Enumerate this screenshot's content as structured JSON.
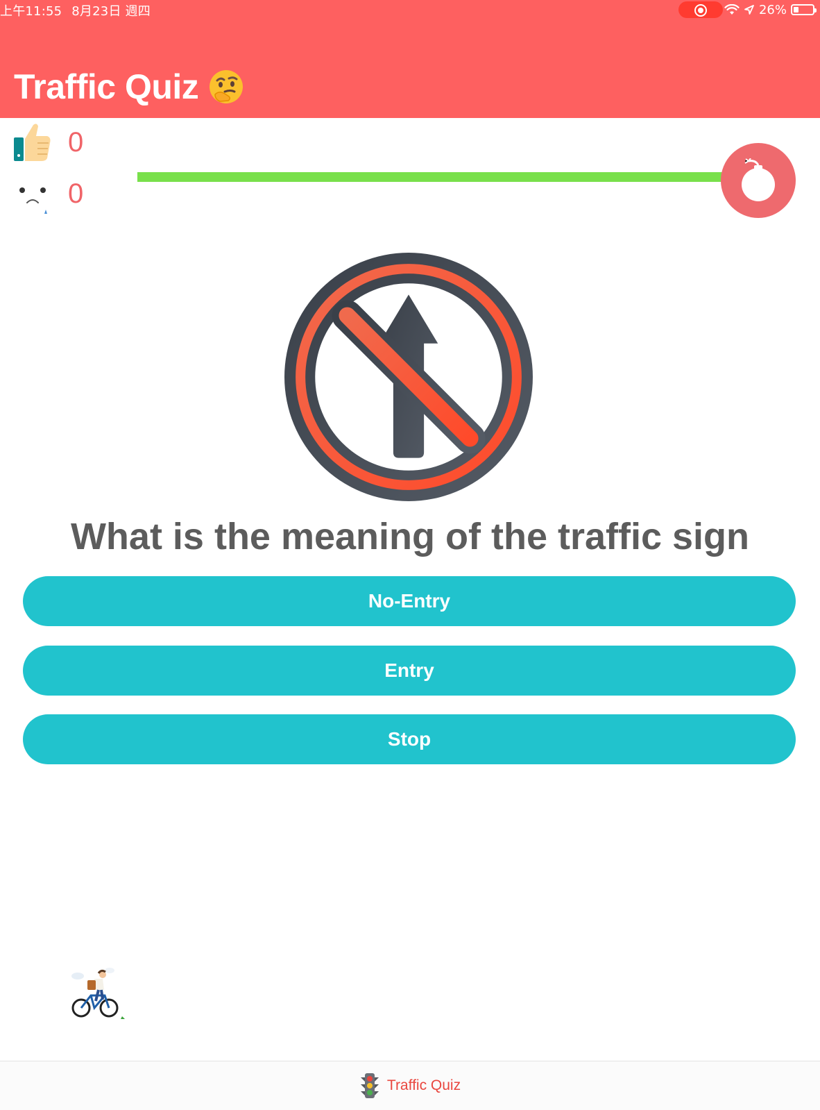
{
  "status_bar": {
    "time": "上午11:55",
    "date": "8月23日 週四",
    "battery": "26%",
    "battery_level": 0.26
  },
  "header": {
    "title": "Traffic Quiz"
  },
  "score": {
    "correct": "0",
    "wrong": "0"
  },
  "timer": {
    "progress": 1.0
  },
  "question": {
    "text": "What is the meaning of the traffic sign"
  },
  "answers": [
    {
      "label": "No-Entry"
    },
    {
      "label": "Entry"
    },
    {
      "label": "Stop"
    }
  ],
  "tab_bar": {
    "items": [
      {
        "label": "Traffic Quiz",
        "icon": "traffic-light-icon"
      }
    ]
  },
  "colors": {
    "header": "#fe6060",
    "accent": "#21c3cd",
    "progress": "#79e04b",
    "score": "#f06468",
    "bomb": "#ee6a6e"
  }
}
